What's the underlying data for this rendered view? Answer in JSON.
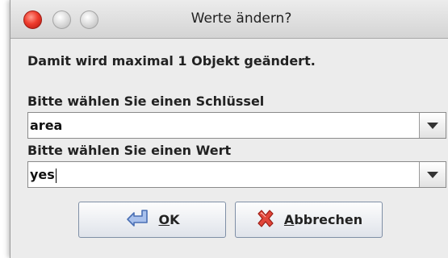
{
  "window": {
    "title": "Werte ändern?"
  },
  "message": "Damit wird maximal 1 Objekt geändert.",
  "key_field": {
    "label": "Bitte wählen Sie einen Schlüssel",
    "value": "area"
  },
  "value_field": {
    "label": "Bitte wählen Sie einen Wert",
    "value": "yes"
  },
  "buttons": {
    "ok": {
      "label_underlined": "O",
      "label_rest": "K",
      "icon": "return-arrow-icon"
    },
    "cancel": {
      "label_underlined": "A",
      "label_rest": "bbrechen",
      "icon": "red-x-icon"
    }
  },
  "colors": {
    "close_button": "#ef3d2e",
    "ok_icon": "#6a8fd0",
    "cancel_icon": "#d4312a"
  }
}
